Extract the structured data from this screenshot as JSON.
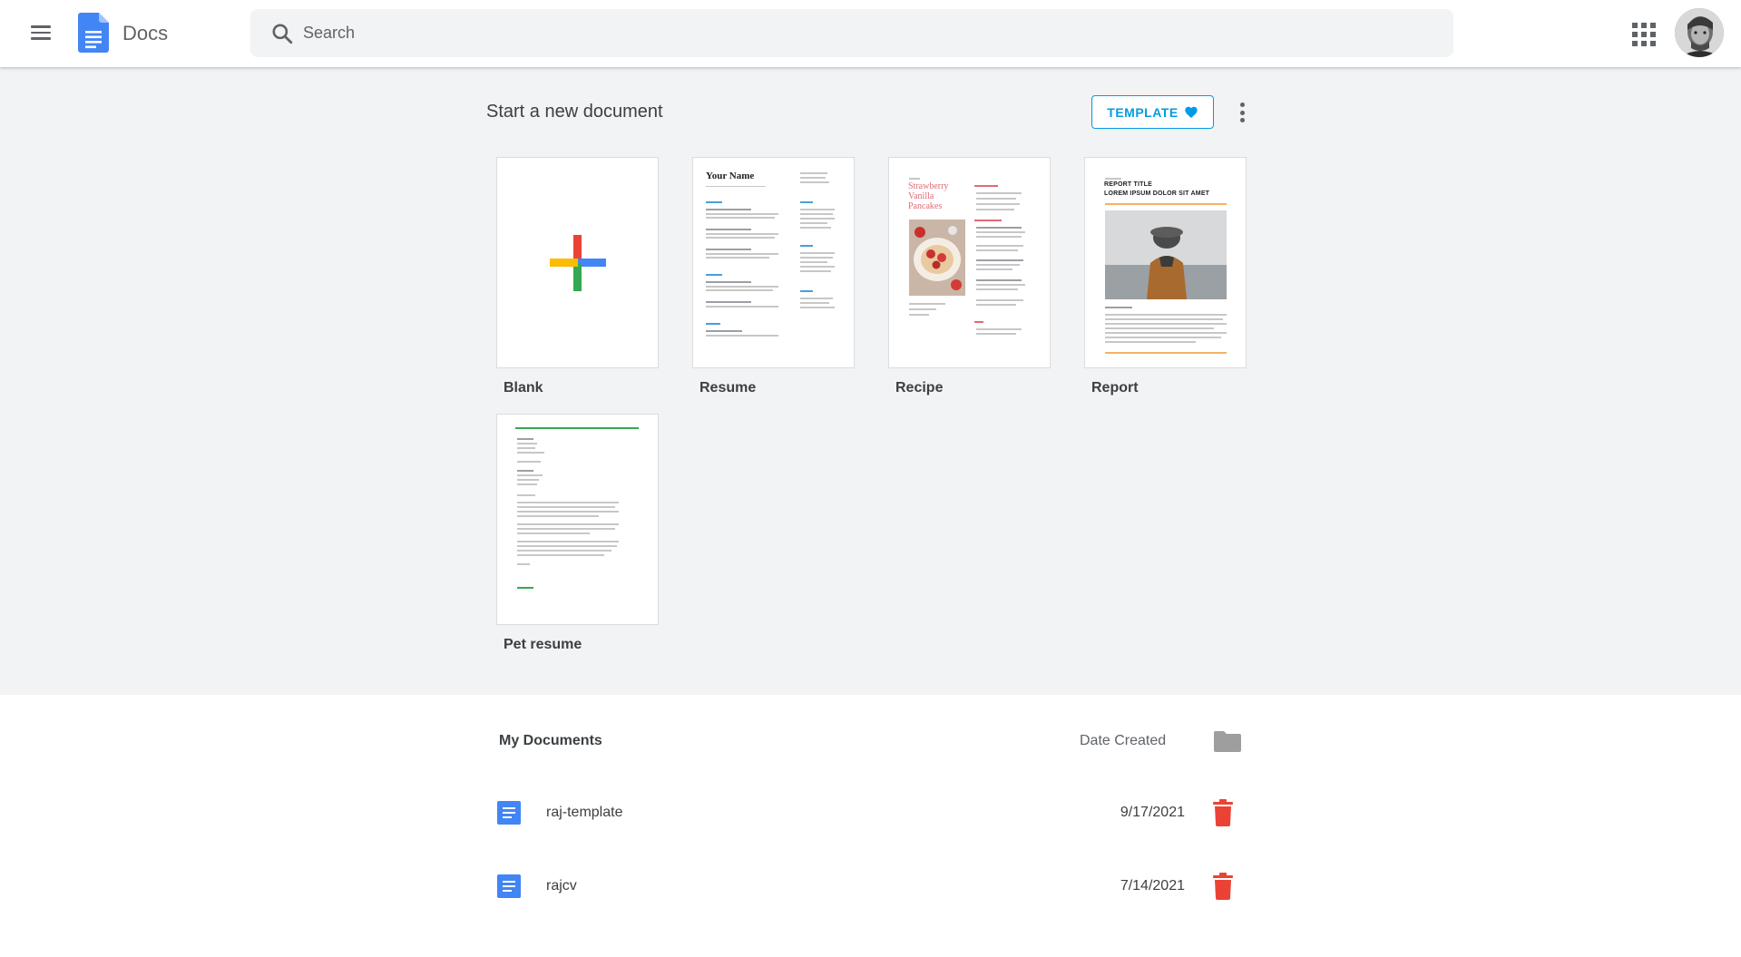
{
  "header": {
    "app_title": "Docs",
    "search_placeholder": "Search"
  },
  "templates": {
    "section_title": "Start a new document",
    "template_button_label": "TEMPLATE",
    "items": [
      {
        "label": "Blank"
      },
      {
        "label": "Resume",
        "preview_name": "Your Name"
      },
      {
        "label": "Recipe",
        "preview_title": "Strawberry Vanilla Pancakes"
      },
      {
        "label": "Report",
        "preview_title": "REPORT TITLE",
        "preview_subtitle": "LOREM IPSUM DOLOR SIT AMET"
      },
      {
        "label": "Pet resume"
      }
    ]
  },
  "documents": {
    "title": "My Documents",
    "date_header": "Date Created",
    "rows": [
      {
        "name": "raj-template",
        "date": "9/17/2021"
      },
      {
        "name": "rajcv",
        "date": "7/14/2021"
      }
    ]
  },
  "colors": {
    "accent": "#039be5",
    "doc_blue": "#4285f4",
    "trash_red": "#ea4335",
    "section_bg": "#f1f3f4"
  }
}
